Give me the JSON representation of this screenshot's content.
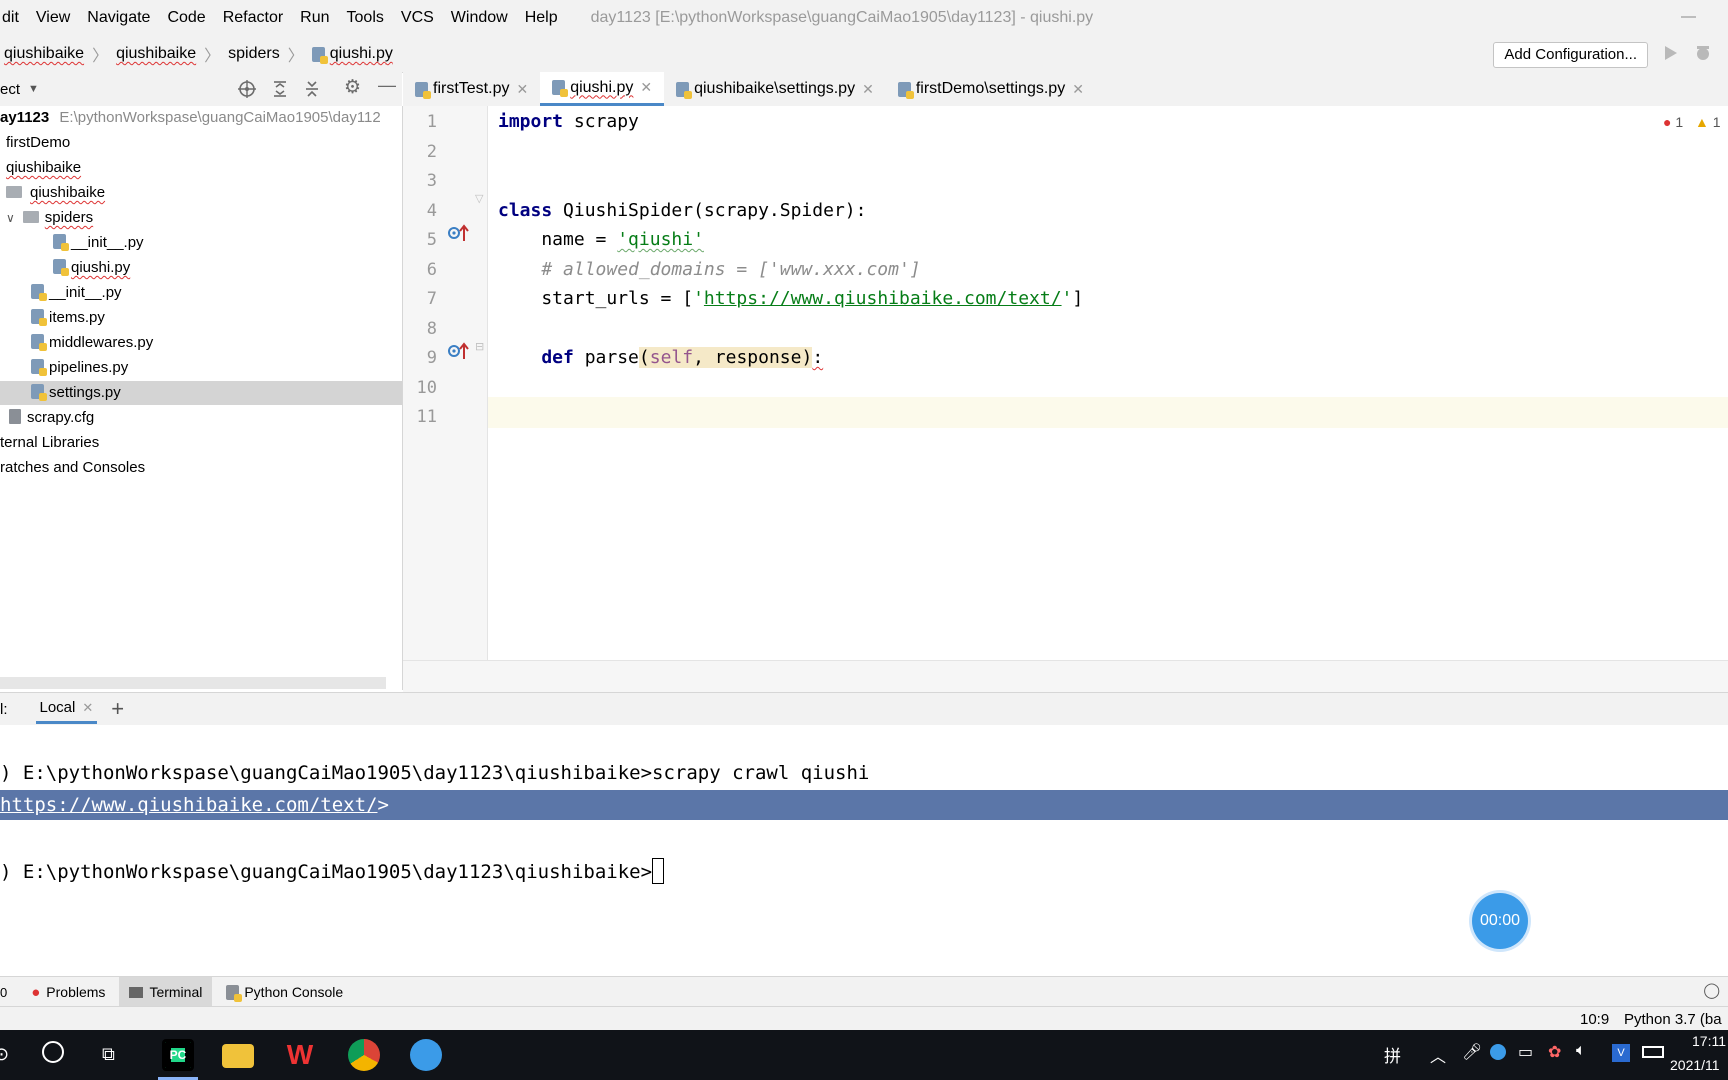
{
  "menubar": {
    "items": [
      "dit",
      "View",
      "Navigate",
      "Code",
      "Refactor",
      "Run",
      "Tools",
      "VCS",
      "Window",
      "Help"
    ],
    "title": "day1123 [E:\\pythonWorkspase\\guangCaiMao1905\\day1123] - qiushi.py"
  },
  "navbar": {
    "crumbs": [
      "qiushibaike",
      "qiushibaike",
      "spiders"
    ],
    "file": "qiushi.py",
    "add_config": "Add Configuration..."
  },
  "project": {
    "header": "ect",
    "root_name": "ay1123",
    "root_path": "E:\\pythonWorkspase\\guangCaiMao1905\\day112",
    "items": [
      {
        "label": "firstDemo"
      },
      {
        "label": "qiushibaike"
      },
      {
        "label": "qiushibaike"
      },
      {
        "label": "spiders"
      },
      {
        "label": "__init__.py"
      },
      {
        "label": "qiushi.py"
      },
      {
        "label": "__init__.py"
      },
      {
        "label": "items.py"
      },
      {
        "label": "middlewares.py"
      },
      {
        "label": "pipelines.py"
      },
      {
        "label": "settings.py"
      },
      {
        "label": "scrapy.cfg"
      },
      {
        "label": "ternal Libraries"
      },
      {
        "label": "ratches and Consoles"
      }
    ]
  },
  "editor": {
    "tabs": [
      "firstTest.py",
      "qiushi.py",
      "qiushibaike\\settings.py",
      "firstDemo\\settings.py"
    ],
    "line_numbers": [
      "1",
      "2",
      "3",
      "4",
      "5",
      "6",
      "7",
      "8",
      "9",
      "10",
      "11"
    ],
    "errors": "1",
    "warnings": "1",
    "code": {
      "l1_kw": "import",
      "l1_rest": " scrapy",
      "l4_kw": "class",
      "l4_rest": " QiushiSpider(scrapy.Spider):",
      "l5_pre": "    name = ",
      "l5_str": "'qiushi'",
      "l6_cmt": "    # allowed_domains = ['www.xxx.com']",
      "l7_pre": "    start_urls = [",
      "l7_q1": "'",
      "l7_url": "https://www.qiushibaike.com/text/",
      "l7_q2": "'",
      "l7_post": "]",
      "l9_kw": "    def",
      "l9_name": " parse",
      "l9_open": "(",
      "l9_self": "self",
      "l9_args": ", response)",
      "l9_colon": ":"
    }
  },
  "terminal": {
    "label": "l:",
    "tab": "Local",
    "line1": ") E:\\pythonWorkspase\\guangCaiMao1905\\day1123\\qiushibaike>scrapy crawl qiushi",
    "line2_url": "https://www.qiushibaike.com/text/",
    "line2_tail": ">",
    "line3": ") E:\\pythonWorkspase\\guangCaiMao1905\\day1123\\qiushibaike>",
    "timer": "00:00"
  },
  "tooltabs": [
    "Problems",
    "Terminal",
    "Python Console"
  ],
  "status": {
    "position": "10:9",
    "interpreter": "Python 3.7 (ba"
  },
  "taskbar": {
    "ime": "拼",
    "time": "17:11",
    "date": "2021/11"
  },
  "colors": {
    "accent": "#4a88c7",
    "terminal_highlight": "#5b76a8",
    "timer": "#3b9be8"
  }
}
